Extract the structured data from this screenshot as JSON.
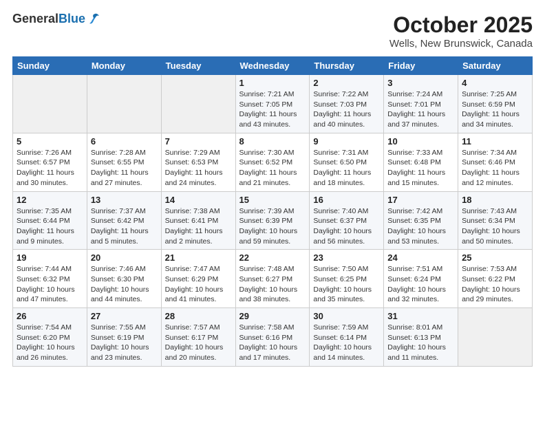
{
  "header": {
    "logo_general": "General",
    "logo_blue": "Blue",
    "title": "October 2025",
    "subtitle": "Wells, New Brunswick, Canada"
  },
  "weekdays": [
    "Sunday",
    "Monday",
    "Tuesday",
    "Wednesday",
    "Thursday",
    "Friday",
    "Saturday"
  ],
  "weeks": [
    [
      {
        "day": "",
        "info": ""
      },
      {
        "day": "",
        "info": ""
      },
      {
        "day": "",
        "info": ""
      },
      {
        "day": "1",
        "info": "Sunrise: 7:21 AM\nSunset: 7:05 PM\nDaylight: 11 hours and 43 minutes."
      },
      {
        "day": "2",
        "info": "Sunrise: 7:22 AM\nSunset: 7:03 PM\nDaylight: 11 hours and 40 minutes."
      },
      {
        "day": "3",
        "info": "Sunrise: 7:24 AM\nSunset: 7:01 PM\nDaylight: 11 hours and 37 minutes."
      },
      {
        "day": "4",
        "info": "Sunrise: 7:25 AM\nSunset: 6:59 PM\nDaylight: 11 hours and 34 minutes."
      }
    ],
    [
      {
        "day": "5",
        "info": "Sunrise: 7:26 AM\nSunset: 6:57 PM\nDaylight: 11 hours and 30 minutes."
      },
      {
        "day": "6",
        "info": "Sunrise: 7:28 AM\nSunset: 6:55 PM\nDaylight: 11 hours and 27 minutes."
      },
      {
        "day": "7",
        "info": "Sunrise: 7:29 AM\nSunset: 6:53 PM\nDaylight: 11 hours and 24 minutes."
      },
      {
        "day": "8",
        "info": "Sunrise: 7:30 AM\nSunset: 6:52 PM\nDaylight: 11 hours and 21 minutes."
      },
      {
        "day": "9",
        "info": "Sunrise: 7:31 AM\nSunset: 6:50 PM\nDaylight: 11 hours and 18 minutes."
      },
      {
        "day": "10",
        "info": "Sunrise: 7:33 AM\nSunset: 6:48 PM\nDaylight: 11 hours and 15 minutes."
      },
      {
        "day": "11",
        "info": "Sunrise: 7:34 AM\nSunset: 6:46 PM\nDaylight: 11 hours and 12 minutes."
      }
    ],
    [
      {
        "day": "12",
        "info": "Sunrise: 7:35 AM\nSunset: 6:44 PM\nDaylight: 11 hours and 9 minutes."
      },
      {
        "day": "13",
        "info": "Sunrise: 7:37 AM\nSunset: 6:42 PM\nDaylight: 11 hours and 5 minutes."
      },
      {
        "day": "14",
        "info": "Sunrise: 7:38 AM\nSunset: 6:41 PM\nDaylight: 11 hours and 2 minutes."
      },
      {
        "day": "15",
        "info": "Sunrise: 7:39 AM\nSunset: 6:39 PM\nDaylight: 10 hours and 59 minutes."
      },
      {
        "day": "16",
        "info": "Sunrise: 7:40 AM\nSunset: 6:37 PM\nDaylight: 10 hours and 56 minutes."
      },
      {
        "day": "17",
        "info": "Sunrise: 7:42 AM\nSunset: 6:35 PM\nDaylight: 10 hours and 53 minutes."
      },
      {
        "day": "18",
        "info": "Sunrise: 7:43 AM\nSunset: 6:34 PM\nDaylight: 10 hours and 50 minutes."
      }
    ],
    [
      {
        "day": "19",
        "info": "Sunrise: 7:44 AM\nSunset: 6:32 PM\nDaylight: 10 hours and 47 minutes."
      },
      {
        "day": "20",
        "info": "Sunrise: 7:46 AM\nSunset: 6:30 PM\nDaylight: 10 hours and 44 minutes."
      },
      {
        "day": "21",
        "info": "Sunrise: 7:47 AM\nSunset: 6:29 PM\nDaylight: 10 hours and 41 minutes."
      },
      {
        "day": "22",
        "info": "Sunrise: 7:48 AM\nSunset: 6:27 PM\nDaylight: 10 hours and 38 minutes."
      },
      {
        "day": "23",
        "info": "Sunrise: 7:50 AM\nSunset: 6:25 PM\nDaylight: 10 hours and 35 minutes."
      },
      {
        "day": "24",
        "info": "Sunrise: 7:51 AM\nSunset: 6:24 PM\nDaylight: 10 hours and 32 minutes."
      },
      {
        "day": "25",
        "info": "Sunrise: 7:53 AM\nSunset: 6:22 PM\nDaylight: 10 hours and 29 minutes."
      }
    ],
    [
      {
        "day": "26",
        "info": "Sunrise: 7:54 AM\nSunset: 6:20 PM\nDaylight: 10 hours and 26 minutes."
      },
      {
        "day": "27",
        "info": "Sunrise: 7:55 AM\nSunset: 6:19 PM\nDaylight: 10 hours and 23 minutes."
      },
      {
        "day": "28",
        "info": "Sunrise: 7:57 AM\nSunset: 6:17 PM\nDaylight: 10 hours and 20 minutes."
      },
      {
        "day": "29",
        "info": "Sunrise: 7:58 AM\nSunset: 6:16 PM\nDaylight: 10 hours and 17 minutes."
      },
      {
        "day": "30",
        "info": "Sunrise: 7:59 AM\nSunset: 6:14 PM\nDaylight: 10 hours and 14 minutes."
      },
      {
        "day": "31",
        "info": "Sunrise: 8:01 AM\nSunset: 6:13 PM\nDaylight: 10 hours and 11 minutes."
      },
      {
        "day": "",
        "info": ""
      }
    ]
  ]
}
